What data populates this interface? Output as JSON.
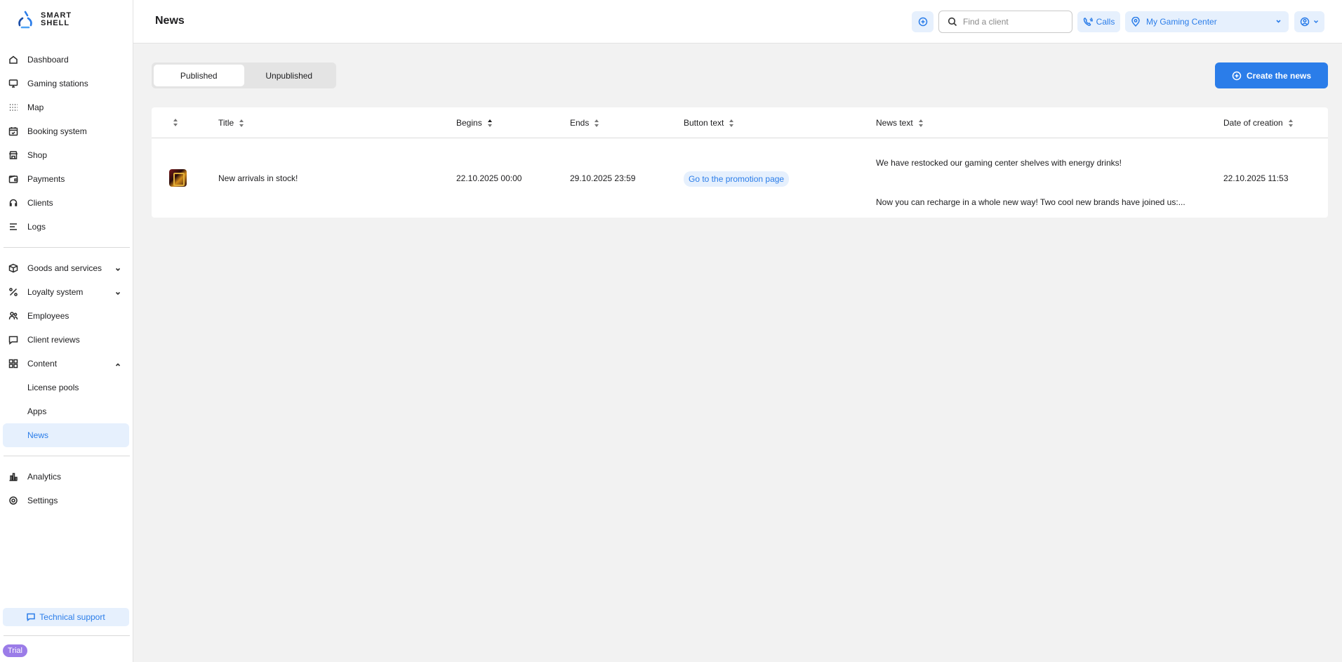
{
  "brand": {
    "line1": "SMART",
    "line2": "SHELL"
  },
  "sidebar": {
    "items": [
      {
        "label": "Dashboard",
        "icon": "home-icon"
      },
      {
        "label": "Gaming stations",
        "icon": "monitor-icon"
      },
      {
        "label": "Map",
        "icon": "map-grid-icon"
      },
      {
        "label": "Booking system",
        "icon": "calendar-icon"
      },
      {
        "label": "Shop",
        "icon": "store-icon"
      },
      {
        "label": "Payments",
        "icon": "wallet-icon"
      },
      {
        "label": "Clients",
        "icon": "headset-icon"
      },
      {
        "label": "Logs",
        "icon": "list-icon"
      }
    ],
    "groups": [
      {
        "label": "Goods and services",
        "icon": "box-icon"
      },
      {
        "label": "Loyalty system",
        "icon": "percent-icon"
      },
      {
        "label": "Employees",
        "icon": "people-icon"
      },
      {
        "label": "Client reviews",
        "icon": "chat-icon"
      },
      {
        "label": "Content",
        "icon": "grid-icon"
      }
    ],
    "content_sub": [
      "License pools",
      "Apps",
      "News"
    ],
    "bottom_items": [
      {
        "label": "Analytics",
        "icon": "bar-chart-icon"
      },
      {
        "label": "Settings",
        "icon": "gear-icon"
      }
    ],
    "support_label": "Technical support",
    "trial_label": "Trial"
  },
  "header": {
    "title": "News",
    "search_placeholder": "Find a client",
    "calls_label": "Calls",
    "location_label": "My Gaming Center"
  },
  "tabs": {
    "published": "Published",
    "unpublished": "Unpublished"
  },
  "create_button": "Create the news",
  "table": {
    "columns": {
      "title": "Title",
      "begins": "Begins",
      "ends": "Ends",
      "button_text": "Button text",
      "news_text": "News text",
      "date_created": "Date of creation"
    },
    "rows": [
      {
        "title": "New arrivals in stock!",
        "begins": "22.10.2025 00:00",
        "ends": "29.10.2025 23:59",
        "button_text": "Go to the promotion page",
        "news_line1": "We have restocked our gaming center shelves with energy drinks!",
        "news_line2": "Now you can recharge in a whole new way! Two cool new brands have joined us:...",
        "date_created": "22.10.2025 11:53"
      }
    ]
  },
  "colors": {
    "accent": "#2b7de9",
    "accent_bg": "#e6f0fd",
    "trial": "#9b7ce8"
  }
}
